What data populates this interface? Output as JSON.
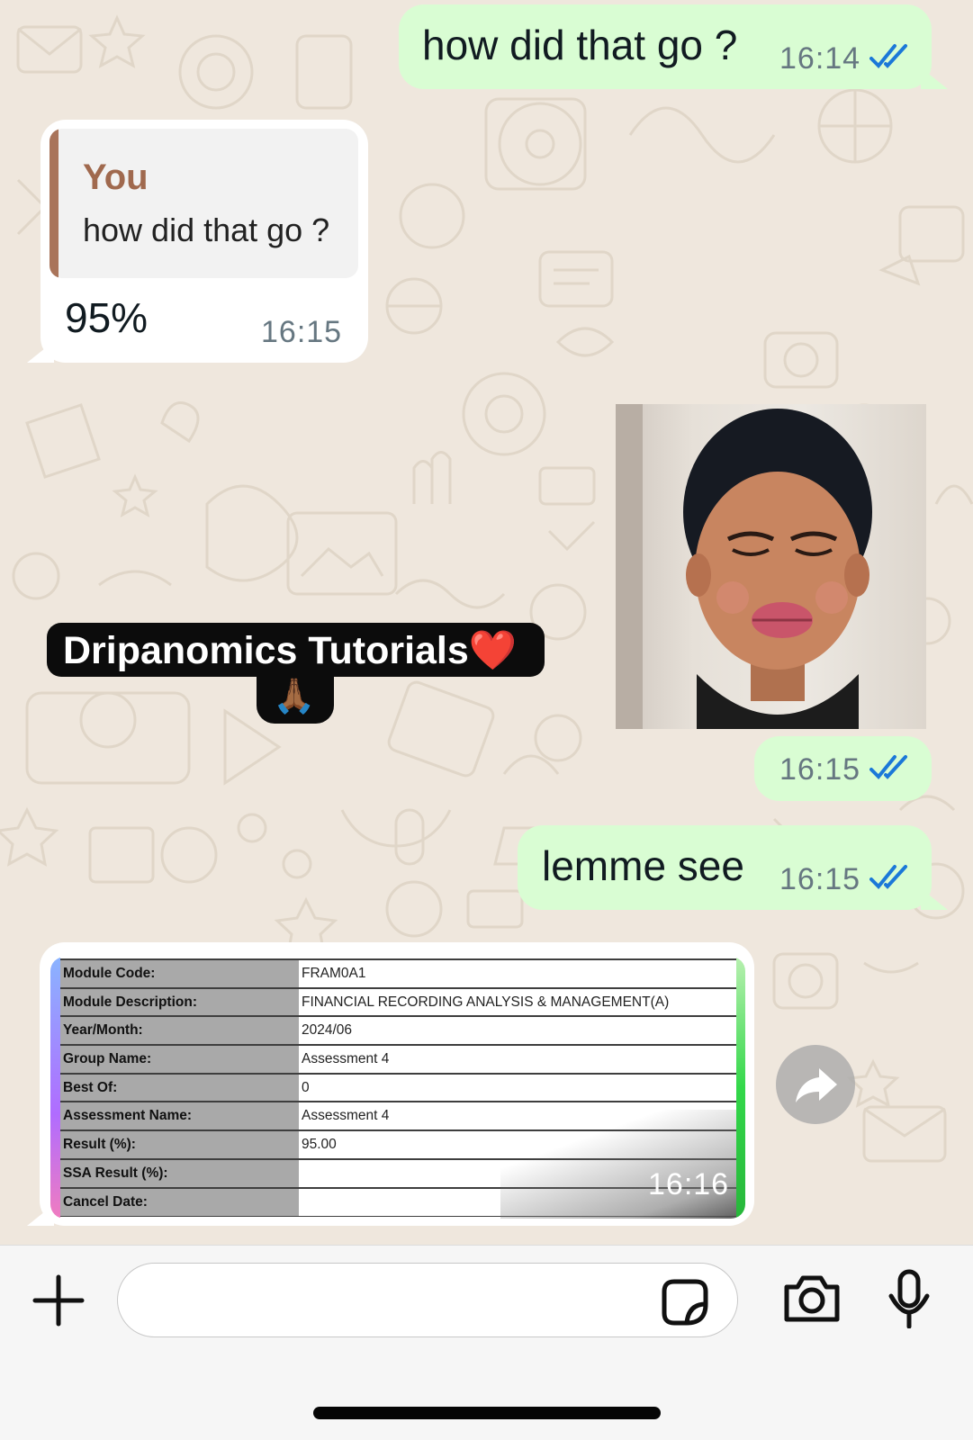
{
  "chat": {
    "messages": [
      {
        "direction": "outgoing",
        "text": "how did that go ?",
        "time": "16:14",
        "status": "read"
      },
      {
        "direction": "incoming",
        "reply_to": {
          "author": "You",
          "text": "how did that go ?"
        },
        "text": "95%",
        "time": "16:15"
      },
      {
        "direction": "outgoing",
        "type": "photo",
        "time": "16:15",
        "status": "read"
      },
      {
        "direction": "incoming",
        "type": "sticker",
        "text": "Dripanomics Tutorials❤️",
        "emoji": "🙏🏾"
      },
      {
        "direction": "outgoing",
        "text": "lemme see",
        "time": "16:15",
        "status": "read"
      },
      {
        "direction": "incoming",
        "type": "image-document",
        "time": "16:16"
      }
    ]
  },
  "document": {
    "rows": [
      {
        "label": "Module Code:",
        "value": "FRAM0A1"
      },
      {
        "label": "Module Description:",
        "value": "FINANCIAL RECORDING ANALYSIS & MANAGEMENT(A)"
      },
      {
        "label": "Year/Month:",
        "value": "2024/06"
      },
      {
        "label": "Group Name:",
        "value": "Assessment 4"
      },
      {
        "label": "Best Of:",
        "value": "0"
      },
      {
        "label": "Assessment Name:",
        "value": "Assessment 4"
      },
      {
        "label": "Result (%):",
        "value": "95.00"
      },
      {
        "label": "SSA Result (%):",
        "value": ""
      },
      {
        "label": "Cancel Date:",
        "value": ""
      }
    ]
  },
  "composer": {
    "icons": [
      "plus-icon",
      "sticker-icon",
      "camera-icon",
      "microphone-icon"
    ]
  },
  "colors": {
    "chat_background": "#efe7dd",
    "outgoing_bubble": "#d9fdd3",
    "incoming_bubble": "#ffffff",
    "read_ticks": "#1b78d8",
    "quote_accent": "#a0694e"
  }
}
